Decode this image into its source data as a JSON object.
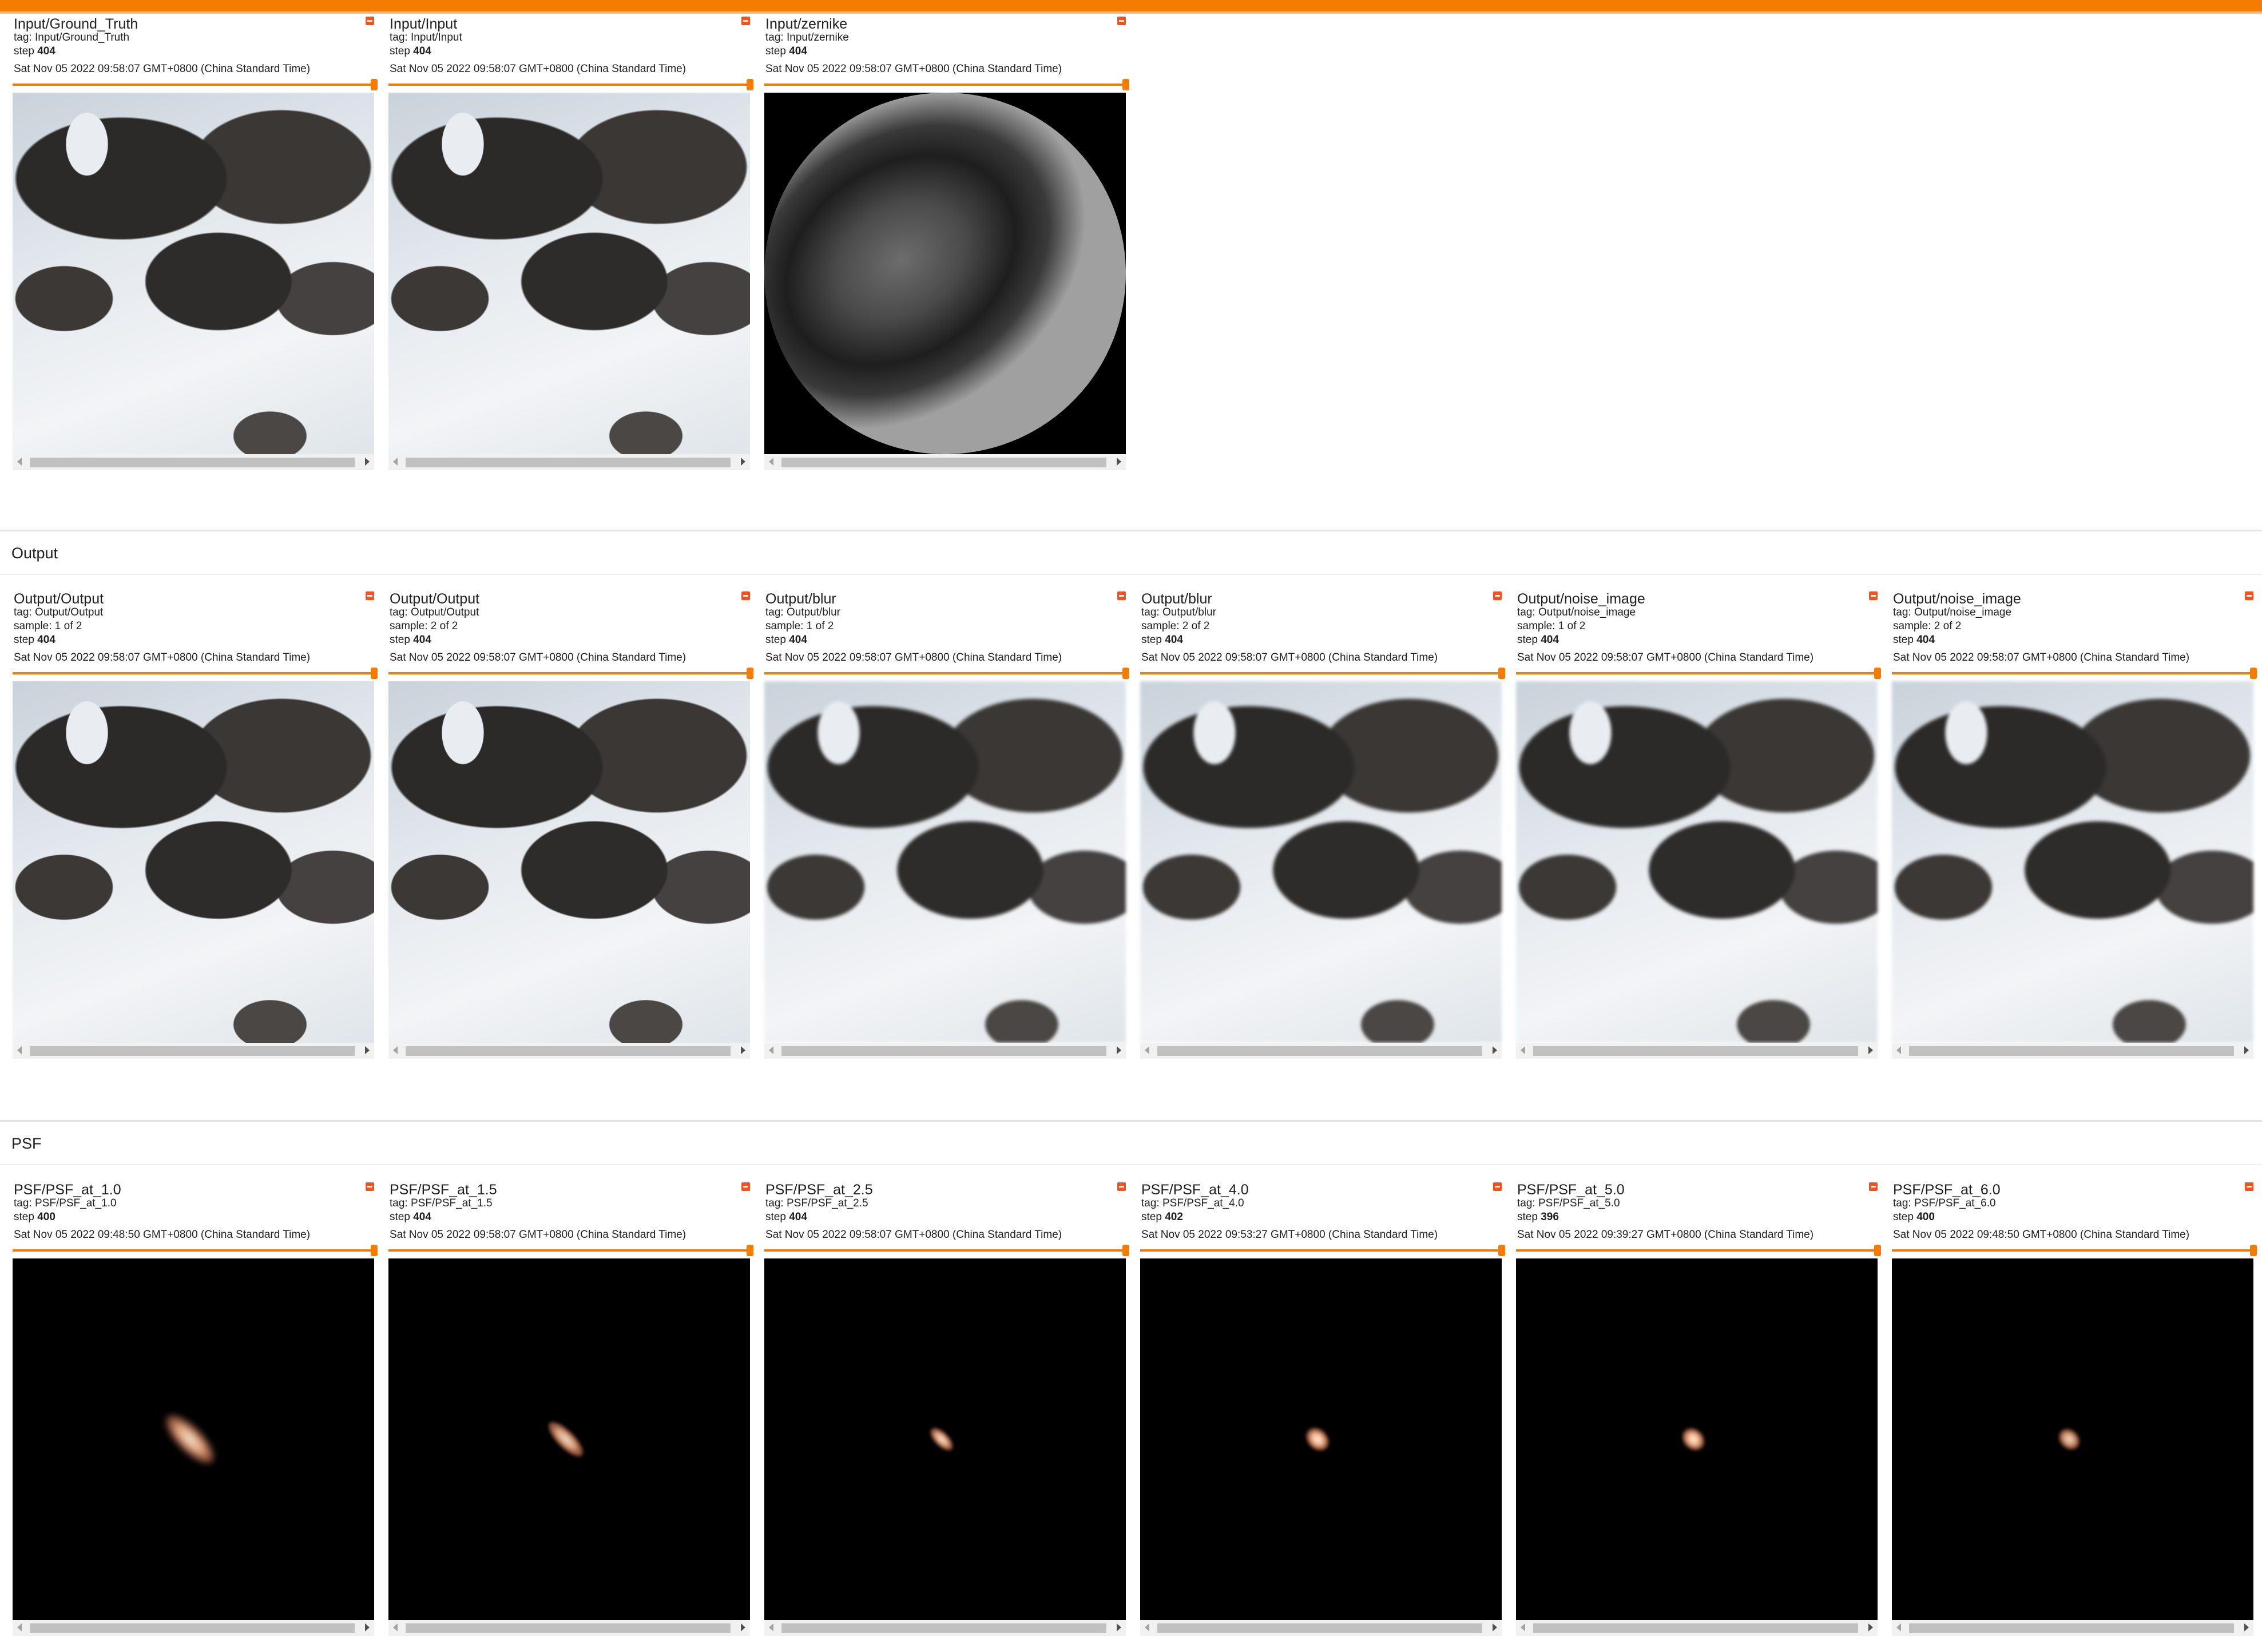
{
  "sections": {
    "output": {
      "title": "Output"
    },
    "psf": {
      "title": "PSF"
    }
  },
  "input_cards": [
    {
      "title": "Input/Ground_Truth",
      "tag": "tag: Input/Ground_Truth",
      "step_label": "step",
      "step": "404",
      "timestamp": "Sat Nov 05 2022 09:58:07 GMT+0800 (China Standard Time)"
    },
    {
      "title": "Input/Input",
      "tag": "tag: Input/Input",
      "step_label": "step",
      "step": "404",
      "timestamp": "Sat Nov 05 2022 09:58:07 GMT+0800 (China Standard Time)"
    },
    {
      "title": "Input/zernike",
      "tag": "tag: Input/zernike",
      "step_label": "step",
      "step": "404",
      "timestamp": "Sat Nov 05 2022 09:58:07 GMT+0800 (China Standard Time)"
    }
  ],
  "output_cards": [
    {
      "title": "Output/Output",
      "tag": "tag: Output/Output",
      "sample": "sample: 1 of 2",
      "step_label": "step",
      "step": "404",
      "timestamp": "Sat Nov 05 2022 09:58:07 GMT+0800 (China Standard Time)"
    },
    {
      "title": "Output/Output",
      "tag": "tag: Output/Output",
      "sample": "sample: 2 of 2",
      "step_label": "step",
      "step": "404",
      "timestamp": "Sat Nov 05 2022 09:58:07 GMT+0800 (China Standard Time)"
    },
    {
      "title": "Output/blur",
      "tag": "tag: Output/blur",
      "sample": "sample: 1 of 2",
      "step_label": "step",
      "step": "404",
      "timestamp": "Sat Nov 05 2022 09:58:07 GMT+0800 (China Standard Time)"
    },
    {
      "title": "Output/blur",
      "tag": "tag: Output/blur",
      "sample": "sample: 2 of 2",
      "step_label": "step",
      "step": "404",
      "timestamp": "Sat Nov 05 2022 09:58:07 GMT+0800 (China Standard Time)"
    },
    {
      "title": "Output/noise_image",
      "tag": "tag: Output/noise_image",
      "sample": "sample: 1 of 2",
      "step_label": "step",
      "step": "404",
      "timestamp": "Sat Nov 05 2022 09:58:07 GMT+0800 (China Standard Time)"
    },
    {
      "title": "Output/noise_image",
      "tag": "tag: Output/noise_image",
      "sample": "sample: 2 of 2",
      "step_label": "step",
      "step": "404",
      "timestamp": "Sat Nov 05 2022 09:58:07 GMT+0800 (China Standard Time)"
    }
  ],
  "psf_cards": [
    {
      "title": "PSF/PSF_at_1.0",
      "tag": "tag: PSF/PSF_at_1.0",
      "step_label": "step",
      "step": "400",
      "timestamp": "Sat Nov 05 2022 09:48:50 GMT+0800 (China Standard Time)"
    },
    {
      "title": "PSF/PSF_at_1.5",
      "tag": "tag: PSF/PSF_at_1.5",
      "step_label": "step",
      "step": "404",
      "timestamp": "Sat Nov 05 2022 09:58:07 GMT+0800 (China Standard Time)"
    },
    {
      "title": "PSF/PSF_at_2.5",
      "tag": "tag: PSF/PSF_at_2.5",
      "step_label": "step",
      "step": "404",
      "timestamp": "Sat Nov 05 2022 09:58:07 GMT+0800 (China Standard Time)"
    },
    {
      "title": "PSF/PSF_at_4.0",
      "tag": "tag: PSF/PSF_at_4.0",
      "step_label": "step",
      "step": "402",
      "timestamp": "Sat Nov 05 2022 09:53:27 GMT+0800 (China Standard Time)"
    },
    {
      "title": "PSF/PSF_at_5.0",
      "tag": "tag: PSF/PSF_at_5.0",
      "step_label": "step",
      "step": "396",
      "timestamp": "Sat Nov 05 2022 09:39:27 GMT+0800 (China Standard Time)"
    },
    {
      "title": "PSF/PSF_at_6.0",
      "tag": "tag: PSF/PSF_at_6.0",
      "step_label": "step",
      "step": "400",
      "timestamp": "Sat Nov 05 2022 09:48:50 GMT+0800 (China Standard Time)"
    }
  ],
  "colors": {
    "accent": "#f57c00",
    "pin": "#f4511e",
    "divider": "#e3e3e3"
  },
  "icons": {
    "pin": "pin-icon",
    "scroll_left": "arrow-left-icon",
    "scroll_right": "arrow-right-icon"
  }
}
